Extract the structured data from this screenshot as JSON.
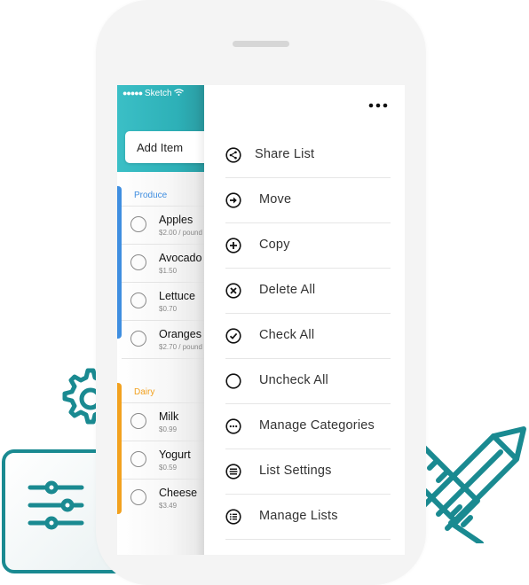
{
  "status_bar": {
    "signal": "●●●●●",
    "carrier": "Sketch"
  },
  "list_screen": {
    "add_item_placeholder": "Add Item",
    "categories": [
      {
        "name": "Produce",
        "color": "#3f8ee0",
        "items": [
          {
            "name": "Apples",
            "price": "$2.00 / pound",
            "checked": false
          },
          {
            "name": "Avocado",
            "price": "$1.50",
            "checked": false
          },
          {
            "name": "Lettuce",
            "price": "$0.70",
            "checked": false
          },
          {
            "name": "Oranges",
            "price": "$2.70 / pound",
            "checked": false
          }
        ]
      },
      {
        "name": "Dairy",
        "color": "#f2a11f",
        "items": [
          {
            "name": "Milk",
            "price": "$0.99",
            "checked": false
          },
          {
            "name": "Yogurt",
            "price": "$0.59",
            "checked": false
          },
          {
            "name": "Cheese",
            "price": "$3.49",
            "checked": false
          }
        ]
      }
    ]
  },
  "drawer": {
    "more_icon": "more-horizontal-icon",
    "menu": [
      {
        "label": "Share List",
        "icon": "share-icon"
      },
      {
        "label": "Move",
        "icon": "arrow-right-circle-icon"
      },
      {
        "label": "Copy",
        "icon": "plus-circle-icon"
      },
      {
        "label": "Delete All",
        "icon": "x-circle-icon"
      },
      {
        "label": "Check All",
        "icon": "check-circle-icon"
      },
      {
        "label": "Uncheck All",
        "icon": "empty-circle-icon"
      },
      {
        "label": "Manage Categories",
        "icon": "more-circle-icon"
      },
      {
        "label": "List Settings",
        "icon": "menu-circle-icon"
      },
      {
        "label": "Manage Lists",
        "icon": "list-circle-icon"
      }
    ]
  },
  "colors": {
    "teal_header": "#33b8bf",
    "decor_teal": "#1a8a91",
    "produce_accent": "#3f8ee0",
    "dairy_accent": "#f2a11f"
  }
}
